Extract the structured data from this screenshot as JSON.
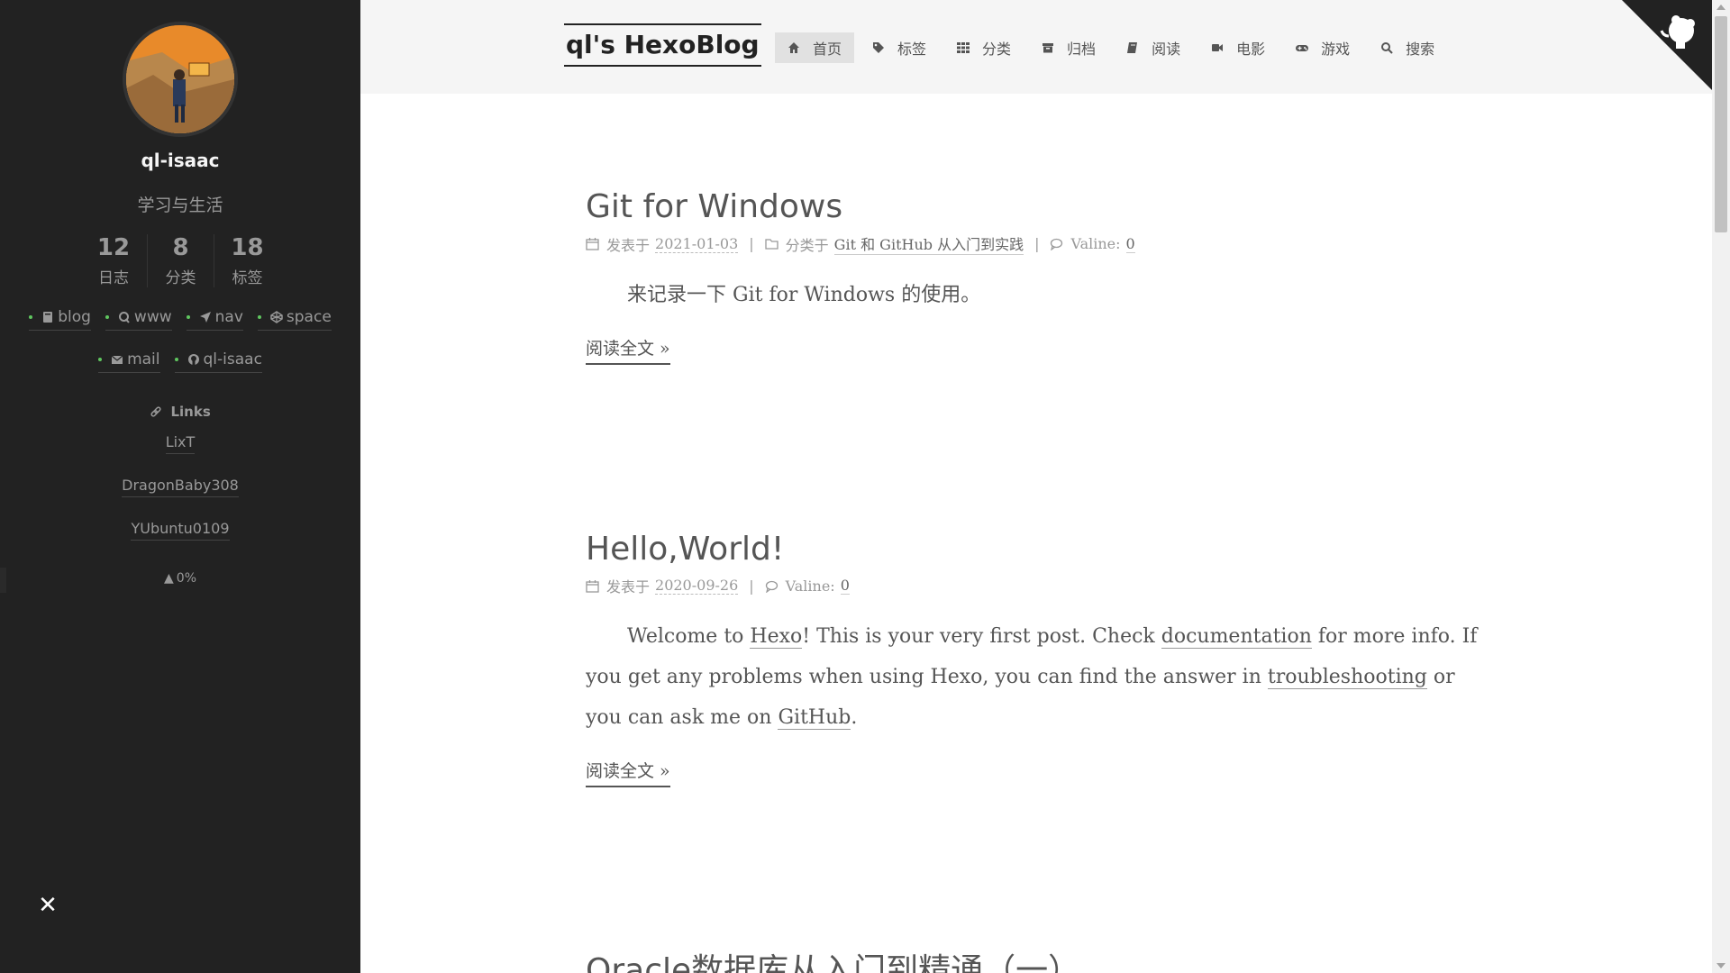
{
  "sidebar": {
    "author_name": "ql-isaac",
    "author_desc": "学习与生活",
    "stats": [
      {
        "count": "12",
        "label": "日志"
      },
      {
        "count": "8",
        "label": "分类"
      },
      {
        "count": "18",
        "label": "标签"
      }
    ],
    "social_row1": [
      {
        "label": "blog",
        "icon": "book-icon"
      },
      {
        "label": "www",
        "icon": "q-icon"
      },
      {
        "label": "nav",
        "icon": "location-arrow-icon"
      },
      {
        "label": "space",
        "icon": "codepen-icon"
      }
    ],
    "social_row2": [
      {
        "label": "mail",
        "icon": "envelope-icon"
      },
      {
        "label": "ql-isaac",
        "icon": "github-icon"
      }
    ],
    "links_title": "Links",
    "blogroll": [
      "LixT",
      "DragonBaby308",
      "YUbuntu0109"
    ],
    "progress": "0%"
  },
  "header": {
    "brand": "ql's HexoBlog",
    "menu": [
      {
        "label": "首页",
        "icon": "home-icon",
        "active": true
      },
      {
        "label": "标签",
        "icon": "tags-icon",
        "active": false
      },
      {
        "label": "分类",
        "icon": "th-icon",
        "active": false
      },
      {
        "label": "归档",
        "icon": "archive-icon",
        "active": false
      },
      {
        "label": "阅读",
        "icon": "book-icon",
        "active": false
      },
      {
        "label": "电影",
        "icon": "video-camera-icon",
        "active": false
      },
      {
        "label": "游戏",
        "icon": "gamepad-icon",
        "active": false
      },
      {
        "label": "搜索",
        "icon": "search-icon",
        "active": false
      }
    ]
  },
  "posts": [
    {
      "title": "Git for Windows",
      "posted_label": "发表于",
      "date": "2021-01-03",
      "category_label": "分类于",
      "category": "Git 和 GitHub 从入门到实践",
      "comment_label": "Valine:",
      "comment_count": "0",
      "excerpt": "来记录一下 Git for Windows 的使用。",
      "readmore": "阅读全文 »"
    },
    {
      "title": "Hello,World!",
      "posted_label": "发表于",
      "date": "2020-09-26",
      "comment_label": "Valine:",
      "comment_count": "0",
      "body": {
        "t1": "Welcome to ",
        "l1": "Hexo",
        "t2": "! This is your very first post. Check ",
        "l2": "documentation",
        "t3": " for more info. If you get any problems when using Hexo, you can find the answer in ",
        "l3": "troubleshooting",
        "t4": " or you can ask me on ",
        "l4": "GitHub",
        "t5": "."
      },
      "readmore": "阅读全文 »"
    },
    {
      "title": "Oracle数据库从入门到精通（一）"
    }
  ],
  "colors": {
    "sidebar_bg": "#222222",
    "header_bg": "#f5f5f5",
    "accent_dot": "#5fc65f",
    "text": "#555555"
  }
}
